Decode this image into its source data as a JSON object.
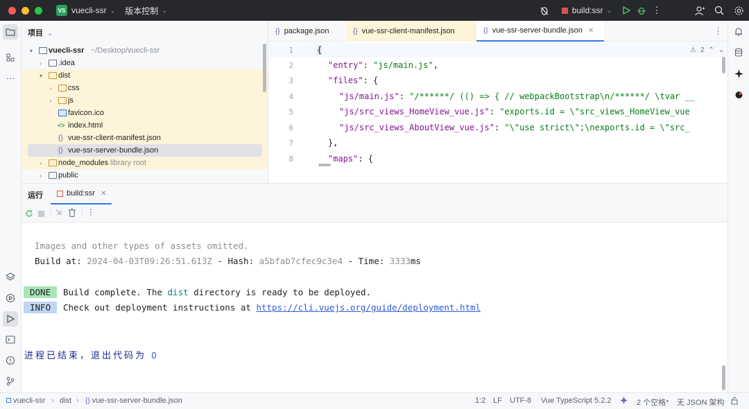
{
  "titlebar": {
    "project_badge": "VS",
    "project_name": "vuecli-ssr",
    "vcs_label": "版本控制",
    "run_config": "build:ssr"
  },
  "project_panel": {
    "title": "项目",
    "tree": [
      {
        "name": "vuecli-ssr",
        "hint": "~/Desktop/vuecli-ssr"
      },
      {
        "name": ".idea"
      },
      {
        "name": "dist"
      },
      {
        "name": "css"
      },
      {
        "name": "js"
      },
      {
        "name": "favicon.ico"
      },
      {
        "name": "index.html"
      },
      {
        "name": "vue-ssr-client-manifest.json"
      },
      {
        "name": "vue-ssr-server-bundle.json"
      },
      {
        "name": "node_modules",
        "hint": "library root"
      },
      {
        "name": "public"
      }
    ]
  },
  "editor": {
    "tabs": [
      {
        "label": "package.json"
      },
      {
        "label": "vue-ssr-client-manifest.json"
      },
      {
        "label": "vue-ssr-server-bundle.json"
      }
    ],
    "warnings": "2",
    "line_numbers": [
      "1",
      "2",
      "3",
      "4",
      "5",
      "6",
      "7",
      "8"
    ],
    "lines": {
      "l1": "{",
      "l2_key": "\"entry\"",
      "l2_rest": ": ",
      "l2_val": "\"js/main.js\"",
      "l2_end": ",",
      "l3_key": "\"files\"",
      "l3_rest": ": {",
      "l4_key": "\"js/main.js\"",
      "l4_rest": ": ",
      "l4_val": "\"/******/ (() => { // webpackBootstrap\\n/******/ \\tvar __",
      "l5_key": "\"js/src_views_HomeView_vue.js\"",
      "l5_rest": ": ",
      "l5_val": "\"exports.id = \\\"src_views_HomeView_vue",
      "l6_key": "\"js/src_views_AboutView_vue.js\"",
      "l6_rest": ": ",
      "l6_val": "\"\\\"use strict\\\";\\nexports.id = \\\"src_",
      "l7": "},",
      "l8_key": "\"maps\"",
      "l8_rest": ": {"
    }
  },
  "run_panel": {
    "tab_label": "运行",
    "config_tab": "build:ssr",
    "console": {
      "line1": "Images and other types of assets omitted.",
      "build_at_label": "Build at: ",
      "build_at_value": "2024-04-03T09:26:51.613Z",
      "hash_label": " - Hash: ",
      "hash_value": "a5bfab7cfec9c3e4",
      "time_label": " - Time: ",
      "time_value": "3333",
      "time_unit": "ms",
      "done_badge": "DONE",
      "done_text_1": "Build complete. The ",
      "done_dist": "dist",
      "done_text_2": " directory is ready to be deployed.",
      "info_badge": "INFO",
      "info_text": "Check out deployment instructions at ",
      "info_link": "https://cli.vuejs.org/guide/deployment.html",
      "exit_text": "进程已结束，退出代码为",
      "exit_code": "0"
    }
  },
  "statusbar": {
    "crumb_project": "vuecli-ssr",
    "crumb_dist": "dist",
    "crumb_file": "vue-ssr-server-bundle.json",
    "position": "1:2",
    "line_sep": "LF",
    "encoding": "UTF-8",
    "language": "Vue TypeScript 5.2.2",
    "indent": "2 个空格*",
    "schema": "无 JSON 架构"
  },
  "colors": {
    "accent": "#3574f0",
    "done_green": "#a8e6b8",
    "info_blue": "#c0d6f5",
    "row_highlight": "#fdf4d9",
    "titlebar": "#27282c"
  }
}
